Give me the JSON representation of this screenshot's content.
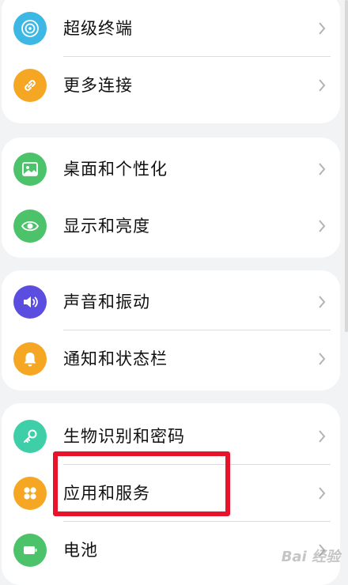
{
  "settings_groups": [
    {
      "items": [
        {
          "label": "超级终端",
          "icon": "super-device-icon",
          "color": "#3db7e4"
        },
        {
          "label": "更多连接",
          "icon": "link-icon",
          "color": "#f5a623"
        }
      ]
    },
    {
      "items": [
        {
          "label": "桌面和个性化",
          "icon": "image-icon",
          "color": "#4cc36a"
        },
        {
          "label": "显示和亮度",
          "icon": "eye-icon",
          "color": "#4cc36a"
        }
      ]
    },
    {
      "items": [
        {
          "label": "声音和振动",
          "icon": "speaker-icon",
          "color": "#5b4de0"
        },
        {
          "label": "通知和状态栏",
          "icon": "bell-icon",
          "color": "#f5a623"
        }
      ]
    },
    {
      "items": [
        {
          "label": "生物识别和密码",
          "icon": "key-icon",
          "color": "#3fcfa8"
        },
        {
          "label": "应用和服务",
          "icon": "apps-icon",
          "color": "#f5a623"
        },
        {
          "label": "电池",
          "icon": "battery-icon",
          "color": "#4cc36a"
        }
      ]
    }
  ],
  "highlight_color": "#e8132a",
  "watermark_text": "Bai 经验"
}
